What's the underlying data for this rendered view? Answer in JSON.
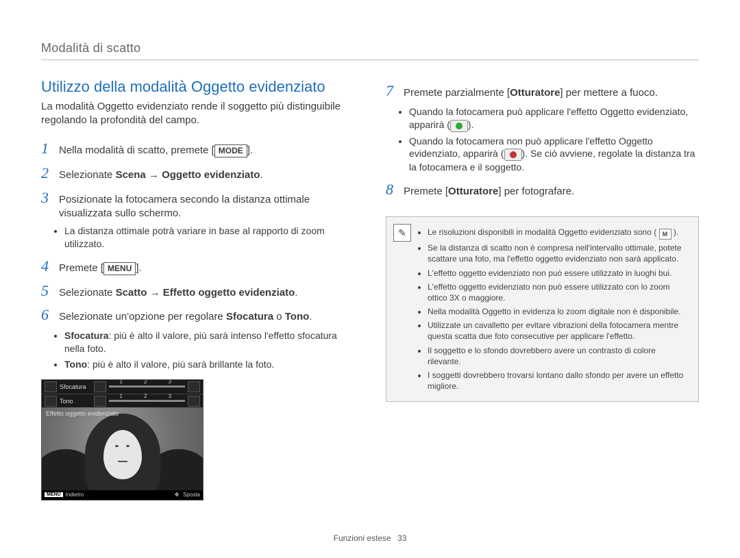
{
  "header": {
    "title": "Modalità di scatto"
  },
  "left": {
    "section_title": "Utilizzo della modalità Oggetto evidenziato",
    "intro": "La modalità Oggetto evidenziato rende il soggetto più distinguibile regolando la profondità del campo.",
    "steps": {
      "s1": {
        "num": "1",
        "pre": "Nella modalità di scatto, premete [",
        "key": "MODE",
        "post": "]."
      },
      "s2": {
        "num": "2",
        "pre": "Selezionate ",
        "bold": "Scena → Oggetto evidenziato",
        "post": "."
      },
      "s3": {
        "num": "3",
        "text": "Posizionate la fotocamera secondo la distanza ottimale visualizzata sullo schermo.",
        "bullets": [
          "La distanza ottimale potrà variare in base al rapporto di zoom utilizzato."
        ]
      },
      "s4": {
        "num": "4",
        "pre": "Premete [",
        "key": "MENU",
        "post": "]."
      },
      "s5": {
        "num": "5",
        "pre": "Selezionate ",
        "bold": "Scatto → Effetto oggetto evidenziato",
        "post": "."
      },
      "s6": {
        "num": "6",
        "pre": "Selezionate un'opzione per regolare ",
        "b1": "Sfocatura",
        "mid": " o ",
        "b2": "Tono",
        "post": ".",
        "bullets_html": [
          {
            "b": "Sfocatura",
            "text": ": più è alto il valore, più sarà intenso l'effetto sfocatura nella foto."
          },
          {
            "b": "Tono",
            "text": ": più è alto il valore, più sarà brillante la foto."
          }
        ]
      }
    },
    "cam": {
      "row1": "Sfocatura",
      "row2": "Tono",
      "ticks": [
        "1",
        "2",
        "3"
      ],
      "overlay": "Effetto oggetto evidenziato",
      "footer_left_key": "MENU",
      "footer_left": "Indietro",
      "footer_right": "Sposta"
    }
  },
  "right": {
    "steps": {
      "s7": {
        "num": "7",
        "pre": "Premete parzialmente [",
        "b": "Otturatore",
        "post": "] per mettere a fuoco.",
        "bullets": [
          {
            "pre": "Quando la fotocamera può applicare l'effetto Oggetto evidenziato, apparirà (",
            "ico": "green",
            "post": ")."
          },
          {
            "pre": "Quando la fotocamera non può applicare l'effetto Oggetto evidenziato, apparirà (",
            "ico": "red",
            "post": "). Se ciò avviene, regolate la distanza tra la fotocamera e il soggetto."
          }
        ]
      },
      "s8": {
        "num": "8",
        "pre": "Premete [",
        "b": "Otturatore",
        "post": "] per fotografare."
      }
    },
    "note": {
      "items": [
        {
          "pre": "Le risoluzioni disponibili in modalità Oggetto evidenziato sono (",
          "ico": "M",
          "post": ")."
        },
        {
          "text": "Se la distanza di scatto non è compresa nell'intervallo ottimale, potete scattare una foto, ma l'effetto oggetto evidenziato non sarà applicato."
        },
        {
          "text": "L'effetto oggetto evidenziato non può essere utilizzato in luoghi bui."
        },
        {
          "text": "L'effetto oggetto evidenziato non può essere utilizzato con lo zoom ottico 3X o maggiore."
        },
        {
          "text": "Nella modalità Oggetto in evidenza lo zoom digitale non è disponibile."
        },
        {
          "text": "Utilizzate un cavalletto per evitare vibrazioni della fotocamera mentre questa scatta due foto consecutive per applicare l'effetto."
        },
        {
          "text": "Il soggetto e lo sfondo dovrebbero avere un contrasto di colore rilevante."
        },
        {
          "text": "I soggetti dovrebbero trovarsi lontano dallo sfondo per avere un effetto migliore."
        }
      ]
    }
  },
  "footer": {
    "section": "Funzioni estese",
    "page": "33"
  }
}
